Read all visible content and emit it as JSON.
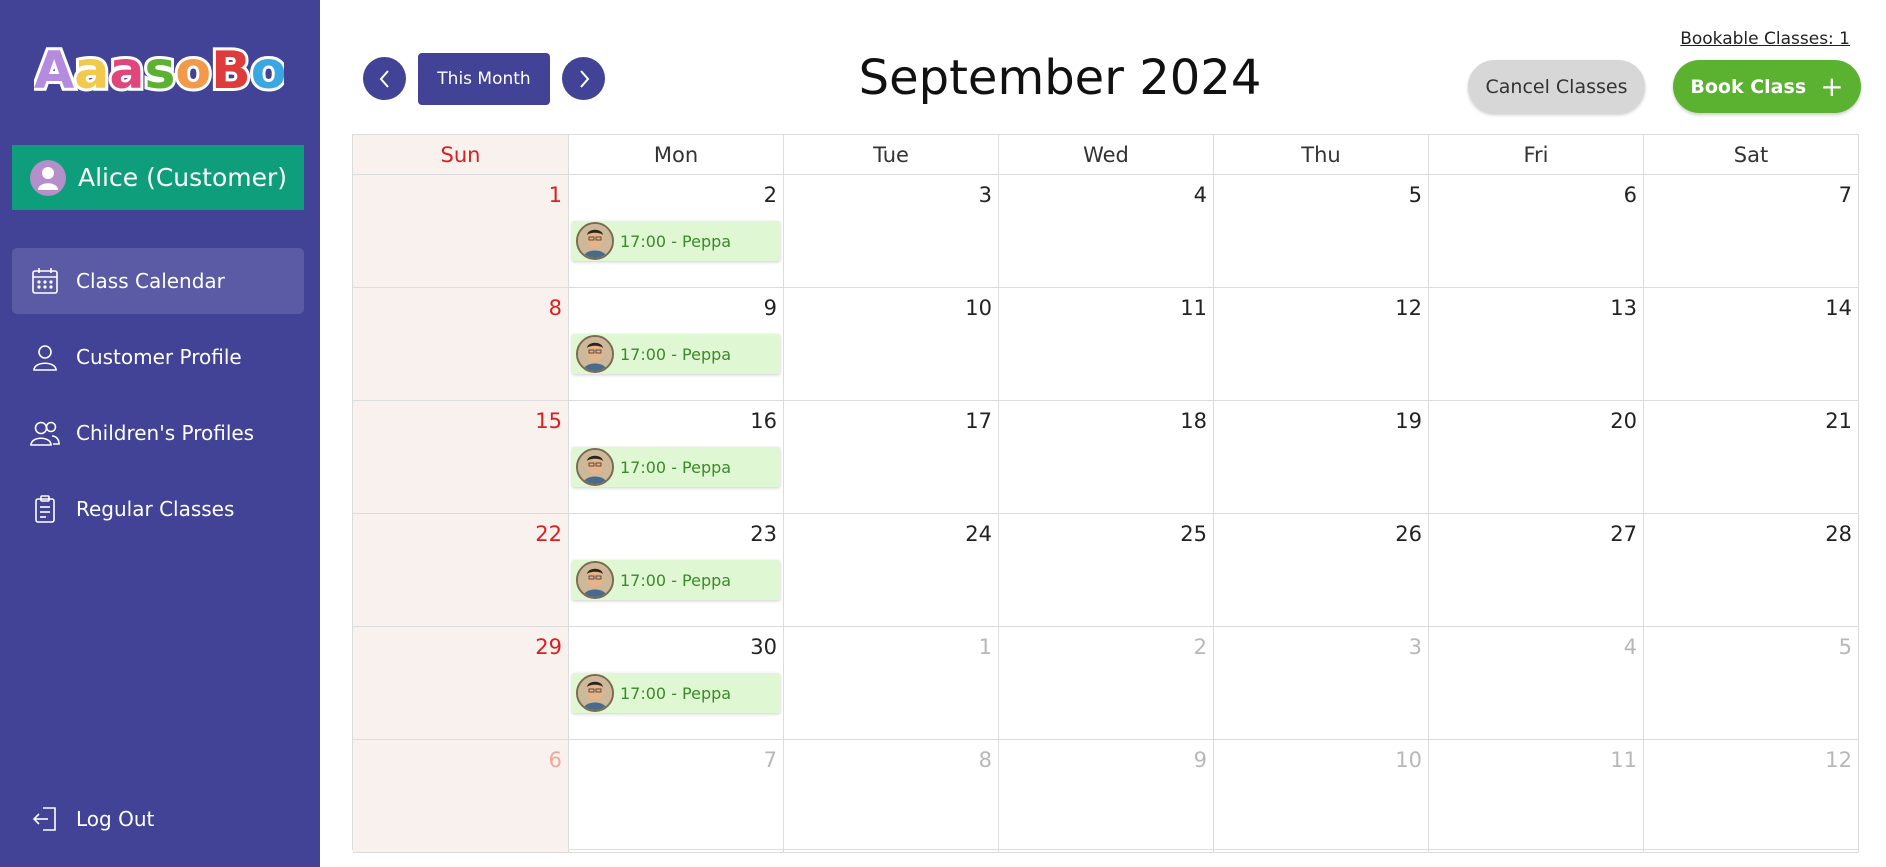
{
  "app": {
    "logo_text": "AaasoBo!",
    "user_label": "Alice (Customer)"
  },
  "sidebar": {
    "items": [
      {
        "label": "Class Calendar",
        "icon": "calendar-icon",
        "active": true
      },
      {
        "label": "Customer Profile",
        "icon": "person-icon",
        "active": false
      },
      {
        "label": "Children's Profiles",
        "icon": "people-icon",
        "active": false
      },
      {
        "label": "Regular Classes",
        "icon": "clipboard-icon",
        "active": false
      }
    ],
    "logout_label": "Log Out"
  },
  "header": {
    "this_month_label": "This Month",
    "month_title": "September 2024",
    "bookable_classes": "Bookable Classes: 1",
    "cancel_label": "Cancel Classes",
    "book_label": "Book Class"
  },
  "calendar": {
    "weekdays": [
      "Sun",
      "Mon",
      "Tue",
      "Wed",
      "Thu",
      "Fri",
      "Sat"
    ],
    "weeks": [
      [
        {
          "d": "1"
        },
        {
          "d": "2",
          "event": "17:00 -  Peppa"
        },
        {
          "d": "3"
        },
        {
          "d": "4"
        },
        {
          "d": "5"
        },
        {
          "d": "6"
        },
        {
          "d": "7"
        }
      ],
      [
        {
          "d": "8"
        },
        {
          "d": "9",
          "event": "17:00 -  Peppa"
        },
        {
          "d": "10"
        },
        {
          "d": "11"
        },
        {
          "d": "12"
        },
        {
          "d": "13"
        },
        {
          "d": "14"
        }
      ],
      [
        {
          "d": "15"
        },
        {
          "d": "16",
          "event": "17:00 -  Peppa"
        },
        {
          "d": "17"
        },
        {
          "d": "18"
        },
        {
          "d": "19"
        },
        {
          "d": "20"
        },
        {
          "d": "21"
        }
      ],
      [
        {
          "d": "22"
        },
        {
          "d": "23",
          "event": "17:00 -  Peppa"
        },
        {
          "d": "24"
        },
        {
          "d": "25"
        },
        {
          "d": "26"
        },
        {
          "d": "27"
        },
        {
          "d": "28"
        }
      ],
      [
        {
          "d": "29"
        },
        {
          "d": "30",
          "event": "17:00 -  Peppa"
        },
        {
          "d": "1",
          "other": true
        },
        {
          "d": "2",
          "other": true
        },
        {
          "d": "3",
          "other": true
        },
        {
          "d": "4",
          "other": true
        },
        {
          "d": "5",
          "other": true
        }
      ],
      [
        {
          "d": "6",
          "other": true
        },
        {
          "d": "7",
          "other": true
        },
        {
          "d": "8",
          "other": true
        },
        {
          "d": "9",
          "other": true
        },
        {
          "d": "10",
          "other": true
        },
        {
          "d": "11",
          "other": true
        },
        {
          "d": "12",
          "other": true
        }
      ]
    ]
  },
  "colors": {
    "sidebar": "#424296",
    "user_box": "#0f9e7b",
    "book_button": "#5bb130",
    "cancel_button": "#d7d7d7",
    "sunday": "#d92020",
    "event_bg": "#e0f7d3"
  }
}
